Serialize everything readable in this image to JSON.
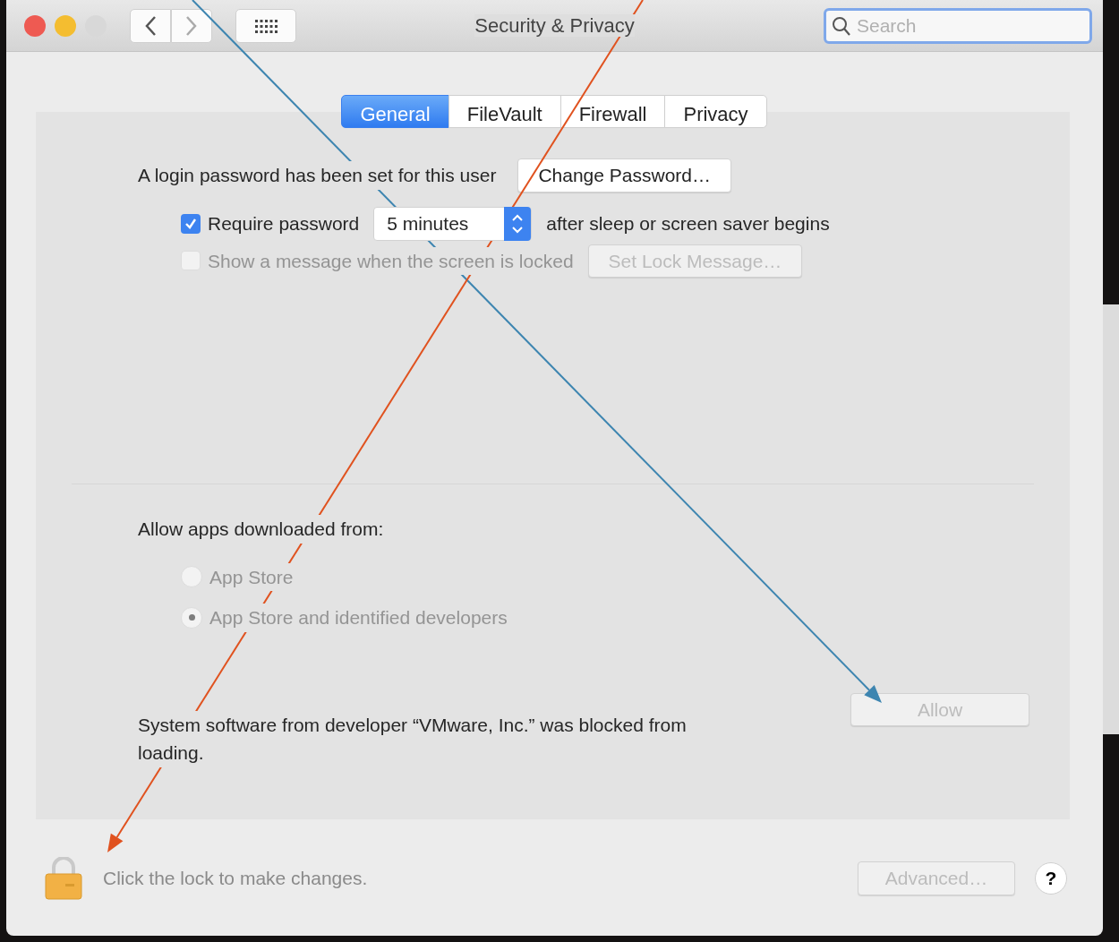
{
  "window": {
    "title": "Security & Privacy"
  },
  "search": {
    "placeholder": "Search"
  },
  "tabs": [
    {
      "label": "General",
      "selected": true
    },
    {
      "label": "FileVault",
      "selected": false
    },
    {
      "label": "Firewall",
      "selected": false
    },
    {
      "label": "Privacy",
      "selected": false
    }
  ],
  "login": {
    "text": "A login password has been set for this user",
    "button": "Change Password…"
  },
  "require_password": {
    "checked": true,
    "label": "Require password",
    "delay": "5 minutes",
    "suffix": "after sleep or screen saver begins"
  },
  "lock_message": {
    "checked": false,
    "disabled": true,
    "label": "Show a message when the screen is locked",
    "button": "Set Lock Message…"
  },
  "allow_apps": {
    "heading": "Allow apps downloaded from:",
    "options": [
      {
        "label": "App Store",
        "selected": false,
        "disabled": true
      },
      {
        "label": "App Store and identified developers",
        "selected": true,
        "disabled": true
      }
    ]
  },
  "blocked": {
    "text": "System software from developer “VMware, Inc.” was blocked from loading.",
    "button": "Allow",
    "disabled": true
  },
  "footer": {
    "lock_text": "Click the lock to make changes.",
    "advanced": "Advanced…",
    "advanced_disabled": true,
    "help": "?"
  },
  "annotations": [
    {
      "kind": "arrow",
      "color": "#3d85b0"
    },
    {
      "kind": "arrow",
      "color": "#e0521f"
    }
  ]
}
